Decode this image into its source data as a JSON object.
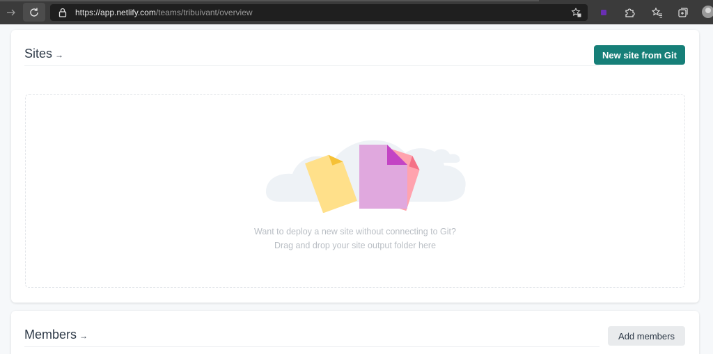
{
  "browser": {
    "url_host": "https://app.netlify.com",
    "url_path": "/teams/tribuivant/overview"
  },
  "sites": {
    "title": "Sites",
    "title_arrow": "→",
    "new_site_label": "New site from Git",
    "dropzone": {
      "line1": "Want to deploy a new site without connecting to Git?",
      "line2": "Drag and drop your site output folder here"
    }
  },
  "members": {
    "title": "Members",
    "title_arrow": "→",
    "add_label": "Add members"
  },
  "colors": {
    "primary": "#167f78",
    "toolbar": "#3b3b3b",
    "file_yellow": "#ffe08a",
    "file_purple": "#e0a8de",
    "file_pink": "#ffa3ae"
  }
}
